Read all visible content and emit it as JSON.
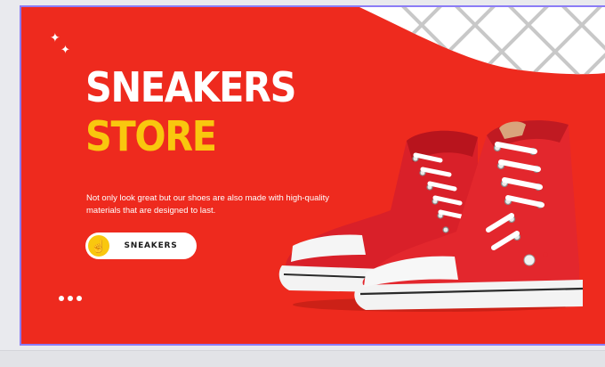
{
  "banner": {
    "title_line1": "SNEAKERS",
    "title_line2": "STORE",
    "tagline": "Not only look great but our shoes are also made with high-quality materials that are designed to last.",
    "cta_label": "SNEAKERS",
    "cta_icon": "hand-pointer-icon",
    "sparkle_glyph": "✦",
    "carousel_dots": 3
  },
  "colors": {
    "background": "#ee2a1e",
    "title_primary": "#ffffff",
    "title_accent": "#f9c70e",
    "button_bg": "#ffffff",
    "button_icon_bg": "#f9c70e",
    "shoe_red": "#e3272d",
    "selection_border": "#8b7cf6"
  }
}
